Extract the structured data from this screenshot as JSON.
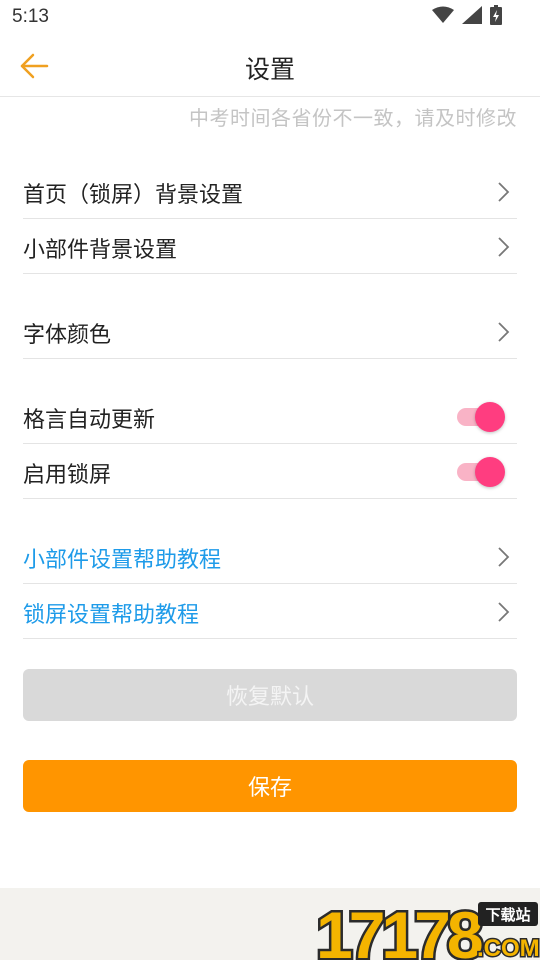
{
  "status_bar": {
    "time": "5:13",
    "icons": [
      "wifi-icon",
      "cell-signal-icon",
      "battery-charging-icon"
    ]
  },
  "header": {
    "title": "设置",
    "back_icon": "arrow-left-icon"
  },
  "notice": "中考时间各省份不一致，请及时修改",
  "settings": {
    "home_lock_background": "首页（锁屏）背景设置",
    "widget_background": "小部件背景设置",
    "font_color": "字体颜色",
    "motto_auto_update": {
      "label": "格言自动更新",
      "enabled": true
    },
    "enable_lock_screen": {
      "label": "启用锁屏",
      "enabled": true
    },
    "widget_help": "小部件设置帮助教程",
    "lock_screen_help": "锁屏设置帮助教程"
  },
  "buttons": {
    "restore_default": "恢复默认",
    "save": "保存"
  },
  "watermark": {
    "number": "17178",
    "badge": "下载站",
    "domain": ".COM"
  },
  "colors": {
    "accent_orange": "#ff9500",
    "link_blue": "#1e9be9",
    "toggle_pink": "#ff3d80",
    "disabled_gray": "#d9d9d9"
  }
}
